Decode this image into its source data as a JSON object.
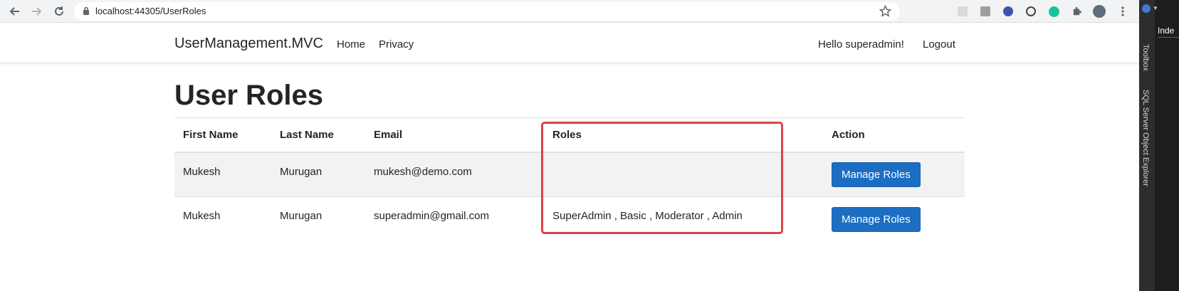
{
  "browser": {
    "url": "localhost:44305/UserRoles"
  },
  "ide": {
    "tab": "Inde",
    "panels": [
      "Toolbox",
      "SQL Server Object Explorer"
    ]
  },
  "navbar": {
    "brand": "UserManagement.MVC",
    "links": [
      "Home",
      "Privacy"
    ],
    "greeting": "Hello superadmin!",
    "logout": "Logout"
  },
  "page": {
    "title": "User Roles"
  },
  "table": {
    "headers": [
      "First Name",
      "Last Name",
      "Email",
      "Roles",
      "Action"
    ],
    "rows": [
      {
        "first_name": "Mukesh",
        "last_name": "Murugan",
        "email": "mukesh@demo.com",
        "roles": "",
        "action": "Manage Roles"
      },
      {
        "first_name": "Mukesh",
        "last_name": "Murugan",
        "email": "superadmin@gmail.com",
        "roles": "SuperAdmin , Basic , Moderator , Admin",
        "action": "Manage Roles"
      }
    ]
  },
  "colors": {
    "highlight": "#d9434a",
    "button": "#1b6ec2"
  }
}
